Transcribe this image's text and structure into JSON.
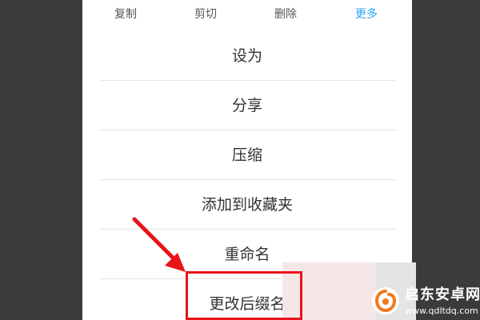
{
  "toolbar": {
    "copy_label": "复制",
    "cut_label": "剪切",
    "delete_label": "删除",
    "more_label": "更多"
  },
  "menu": {
    "items": [
      {
        "label": "设为"
      },
      {
        "label": "分享"
      },
      {
        "label": "压缩"
      },
      {
        "label": "添加到收藏夹"
      },
      {
        "label": "重命名"
      },
      {
        "label": "更改后缀名"
      }
    ]
  },
  "watermark": {
    "title": "启东安卓网",
    "url": "www.qdltdq.com"
  },
  "colors": {
    "accent": "#2aa3f5",
    "highlight": "#e8141a",
    "watermark_orange": "#f07a1e"
  },
  "icons": {
    "annotation_arrow": "red-arrow-icon",
    "watermark_logo": "watermark-logo-icon"
  }
}
